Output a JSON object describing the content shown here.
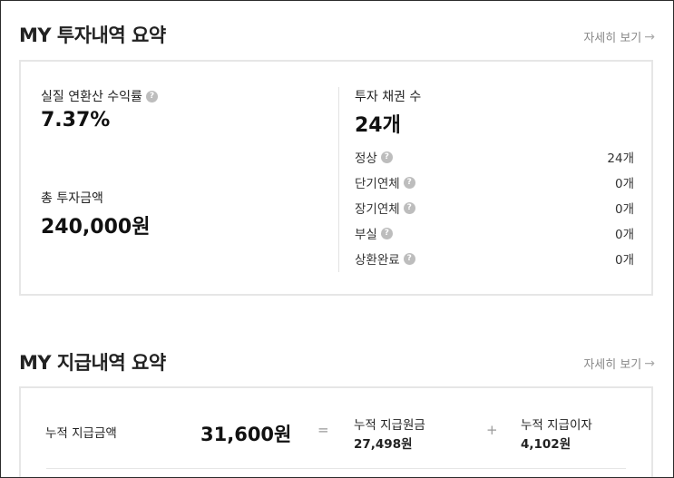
{
  "investment": {
    "title": "MY 투자내역 요약",
    "more_link": "자세히 보기",
    "annual_return_label": "실질 연환산 수익률",
    "annual_return_value": "7.37%",
    "total_invest_label": "총 투자금액",
    "total_invest_value": "240,000원",
    "bond_count_label": "투자 채권 수",
    "bond_count_value": "24개",
    "statuses": [
      {
        "label": "정상",
        "value": "24개"
      },
      {
        "label": "단기연체",
        "value": "0개"
      },
      {
        "label": "장기연체",
        "value": "0개"
      },
      {
        "label": "부실",
        "value": "0개"
      },
      {
        "label": "상환완료",
        "value": "0개"
      }
    ]
  },
  "payment": {
    "title": "MY 지급내역 요약",
    "more_link": "자세히 보기",
    "cumulative_label": "누적 지급금액",
    "cumulative_value": "31,600원",
    "equals": "=",
    "plus": "+",
    "principal_label": "누적 지급원금",
    "principal_value": "27,498원",
    "interest_label": "누적 지급이자",
    "interest_value": "4,102원"
  },
  "icons": {
    "help": "?",
    "arrow": "→"
  }
}
